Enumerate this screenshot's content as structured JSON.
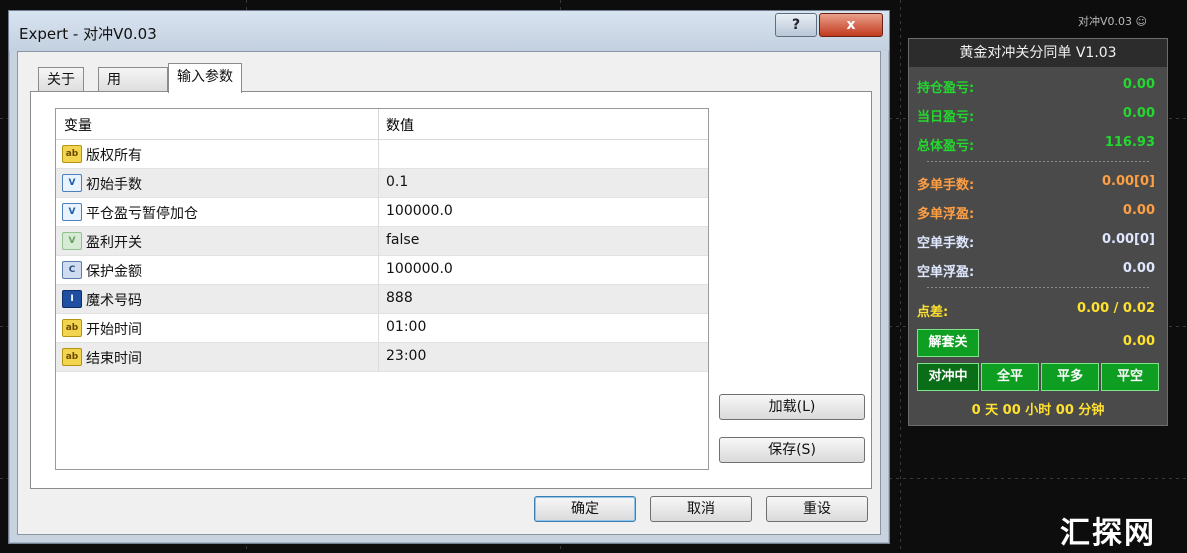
{
  "dialog": {
    "title": "Expert - 对冲V0.03",
    "help_label": "?",
    "close_label": "x",
    "tabs": [
      {
        "label": "关于"
      },
      {
        "label": "   用"
      },
      {
        "label": "输入参数"
      }
    ],
    "table": {
      "col_name": "变量",
      "col_value": "数值",
      "rows": [
        {
          "icon": "ab",
          "name": "版权所有",
          "value": ""
        },
        {
          "icon": "V",
          "name": "初始手数",
          "value": "0.1"
        },
        {
          "icon": "V",
          "name": "平仓盈亏暂停加仓",
          "value": "100000.0"
        },
        {
          "icon": "V",
          "name": "盈利开关",
          "value": "false"
        },
        {
          "icon": "C",
          "name": "保护金额",
          "value": "100000.0"
        },
        {
          "icon": "I",
          "name": "魔术号码",
          "value": "888"
        },
        {
          "icon": "ab",
          "name": "开始时间",
          "value": "01:00"
        },
        {
          "icon": "ab",
          "name": "结束时间",
          "value": "23:00"
        }
      ]
    },
    "load_label": "加载(L)",
    "save_label": "保存(S)",
    "ok_label": "确定",
    "cancel_label": "取消",
    "reset_label": "重设"
  },
  "ea": {
    "corner_label": "对冲V0.03",
    "header": "黄金对冲关分同单 V1.03",
    "rows": [
      {
        "label": "持仓盈亏:",
        "value": "0.00",
        "color": "#23d82e"
      },
      {
        "label": "当日盈亏:",
        "value": "0.00",
        "color": "#23d82e"
      },
      {
        "label": "总体盈亏:",
        "value": "116.93",
        "color": "#23d82e"
      }
    ],
    "rows2": [
      {
        "label": "多单手数:",
        "value": "0.00[0]",
        "color": "#ff9f43"
      },
      {
        "label": "多单浮盈:",
        "value": "0.00",
        "color": "#ff9f43"
      },
      {
        "label": "空单手数:",
        "value": "0.00[0]",
        "color": "#dfe7ff"
      },
      {
        "label": "空单浮盈:",
        "value": "0.00",
        "color": "#dfe7ff"
      }
    ],
    "spread_label": "点差:",
    "spread_value": "0.00 / 0.02",
    "unlock_label": "解套关",
    "unlock_value": "0.00",
    "buttons": [
      "对冲中",
      "全平",
      "平多",
      "平空"
    ],
    "timer": "0 天 00 小时 00 分钟"
  },
  "watermark": "汇探网"
}
